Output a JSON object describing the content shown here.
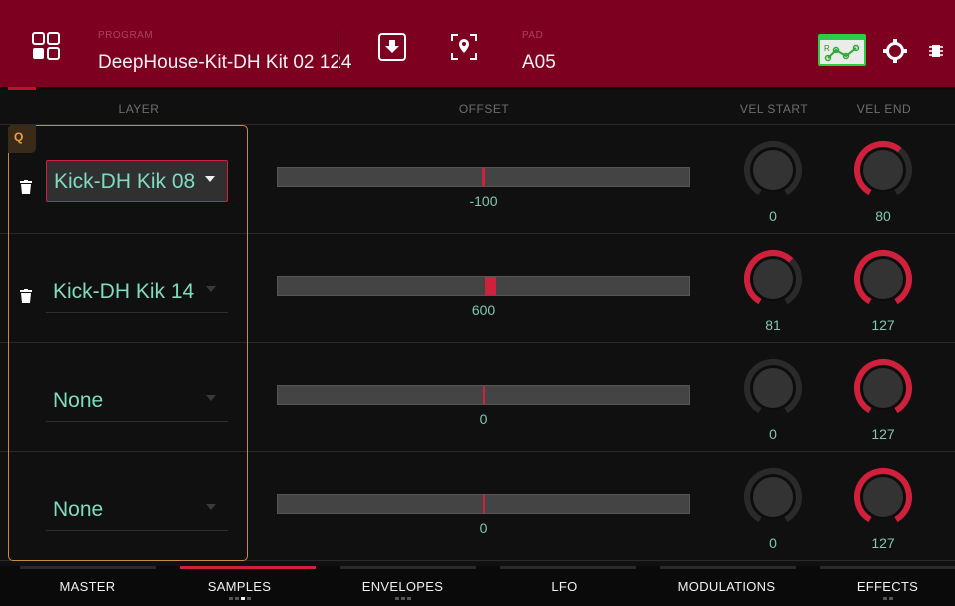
{
  "header": {
    "program_label": "PROGRAM",
    "program_name": "DeepHouse-Kit-DH Kit 02 124",
    "pad_label": "PAD",
    "pad_value": "A05",
    "colors": {
      "header_bg": "#7d0020",
      "accent": "#d0203c",
      "automation": "#2ecc40"
    },
    "icons": [
      "grid-menu-icon",
      "save-download-icon",
      "locate-pad-icon",
      "automation-icon",
      "gear-icon",
      "chip-icon"
    ]
  },
  "columns": {
    "layer": "LAYER",
    "offset": "OFFSET",
    "vel_start": "VEL START",
    "vel_end": "VEL END"
  },
  "q_badge": "Q",
  "layers": [
    {
      "sample": "Kick-DH Kik 08",
      "offset": "-100",
      "offset_fraction": 0.497,
      "vel_start": "0",
      "vel_end": "80"
    },
    {
      "sample": "Kick-DH Kik 14",
      "offset": "600",
      "offset_fraction": 0.515,
      "vel_start": "81",
      "vel_end": "127"
    },
    {
      "sample": "None",
      "offset": "0",
      "offset_fraction": 0.5,
      "vel_start": "0",
      "vel_end": "127"
    },
    {
      "sample": "None",
      "offset": "0",
      "offset_fraction": 0.5,
      "vel_start": "0",
      "vel_end": "127"
    }
  ],
  "tabs": [
    {
      "label": "MASTER",
      "active": false,
      "dots": 0
    },
    {
      "label": "SAMPLES",
      "active": true,
      "dots": 4,
      "dot_on": 2
    },
    {
      "label": "ENVELOPES",
      "active": false,
      "dots": 3
    },
    {
      "label": "LFO",
      "active": false,
      "dots": 0
    },
    {
      "label": "MODULATIONS",
      "active": false,
      "dots": 0
    },
    {
      "label": "EFFECTS",
      "active": false,
      "dots": 2
    }
  ]
}
